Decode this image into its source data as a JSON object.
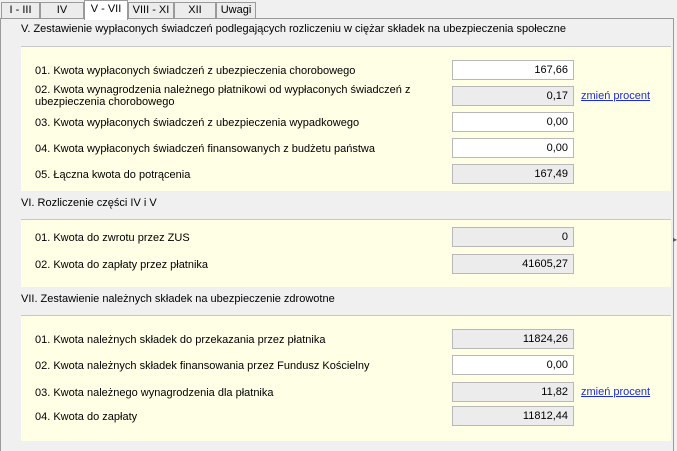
{
  "tabs": [
    {
      "label": "I - III"
    },
    {
      "label": "IV"
    },
    {
      "label": "V - VII"
    },
    {
      "label": "VIII - XI"
    },
    {
      "label": "XII"
    },
    {
      "label": "Uwagi"
    }
  ],
  "active_tab": "V - VII",
  "section_v": {
    "header": "V. Zestawienie wypłaconych świadczeń podlegających rozliczeniu w ciężar składek na ubezpieczenia społeczne",
    "rows": [
      {
        "label": "01. Kwota wypłaconych świadczeń z ubezpieczenia chorobowego",
        "value": "167,66"
      },
      {
        "label": "02. Kwota wynagrodzenia należnego płatnikowi od wypłaconych świadczeń z ubezpieczenia chorobowego",
        "value": "0,17"
      },
      {
        "label": "03. Kwota wypłaconych świadczeń z ubezpieczenia wypadkowego",
        "value": "0,00"
      },
      {
        "label": "04. Kwota wypłaconych świadczeń finansowanych z budżetu państwa",
        "value": "0,00"
      },
      {
        "label": "05. Łączna kwota do potrącenia",
        "value": "167,49"
      }
    ],
    "link": "zmień procent"
  },
  "section_vi": {
    "header": "VI. Rozliczenie części IV i V",
    "rows": [
      {
        "label": "01. Kwota do zwrotu przez ZUS",
        "value": "0"
      },
      {
        "label": "02. Kwota do zapłaty przez płatnika",
        "value": "41605,27"
      }
    ]
  },
  "section_vii": {
    "header": "VII. Zestawienie należnych składek na ubezpieczenie zdrowotne",
    "rows": [
      {
        "label": "01. Kwota należnych składek do przekazania przez płatnika",
        "value": "11824,26"
      },
      {
        "label": "02. Kwota należnych składek finansowania przez Fundusz Kościelny",
        "value": "0,00"
      },
      {
        "label": "03. Kwota należnego wynagrodzenia dla płatnika",
        "value": "11,82"
      },
      {
        "label": "04. Kwota do zapłaty",
        "value": "11812,44"
      }
    ],
    "link": "zmień procent"
  }
}
